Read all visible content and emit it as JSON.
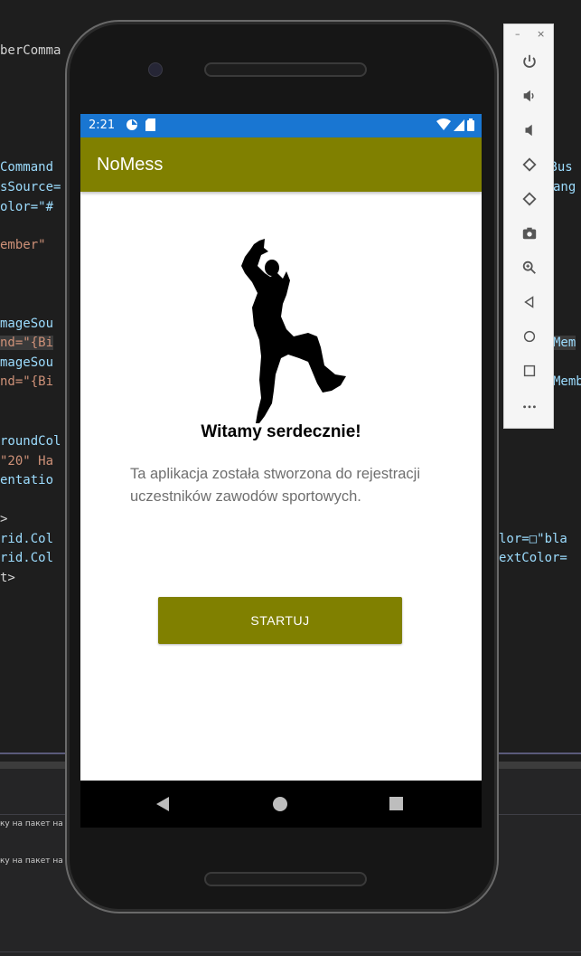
{
  "ide": {
    "code_left": [
      "berComma",
      "Command",
      "sSource=",
      "olor=\"#",
      "ember\"",
      "mageSou",
      "nd=\"{Bi",
      "mageSou",
      "nd=\"{Bi",
      "roundCol",
      "\"20\" Ha",
      "entatio",
      ">",
      "rid.Col",
      "rid.Col",
      "t>"
    ],
    "code_right": [
      "sBus",
      "ang",
      "Mem",
      "Memb",
      "lor=□\"bla",
      "extColor="
    ],
    "messages": [
      "ку на пакет на",
      "ку на пакет на"
    ]
  },
  "emulator_toolbar": {
    "window_controls": [
      "–",
      "×"
    ],
    "buttons": [
      "power-icon",
      "volume-up-icon",
      "volume-down-icon",
      "rotate-left-icon",
      "rotate-right-icon",
      "camera-icon",
      "zoom-icon",
      "back-icon",
      "home-icon",
      "overview-icon",
      "more-icon"
    ]
  },
  "statusbar": {
    "time": "2:21",
    "color": "#1976d2"
  },
  "app": {
    "title": "NoMess",
    "accent_color": "#808000",
    "welcome": "Witamy serdecznie!",
    "description": "Ta aplikacja została stworzona do rejestracji uczestników zawodów sportowych.",
    "start_button": "STARTUJ"
  }
}
